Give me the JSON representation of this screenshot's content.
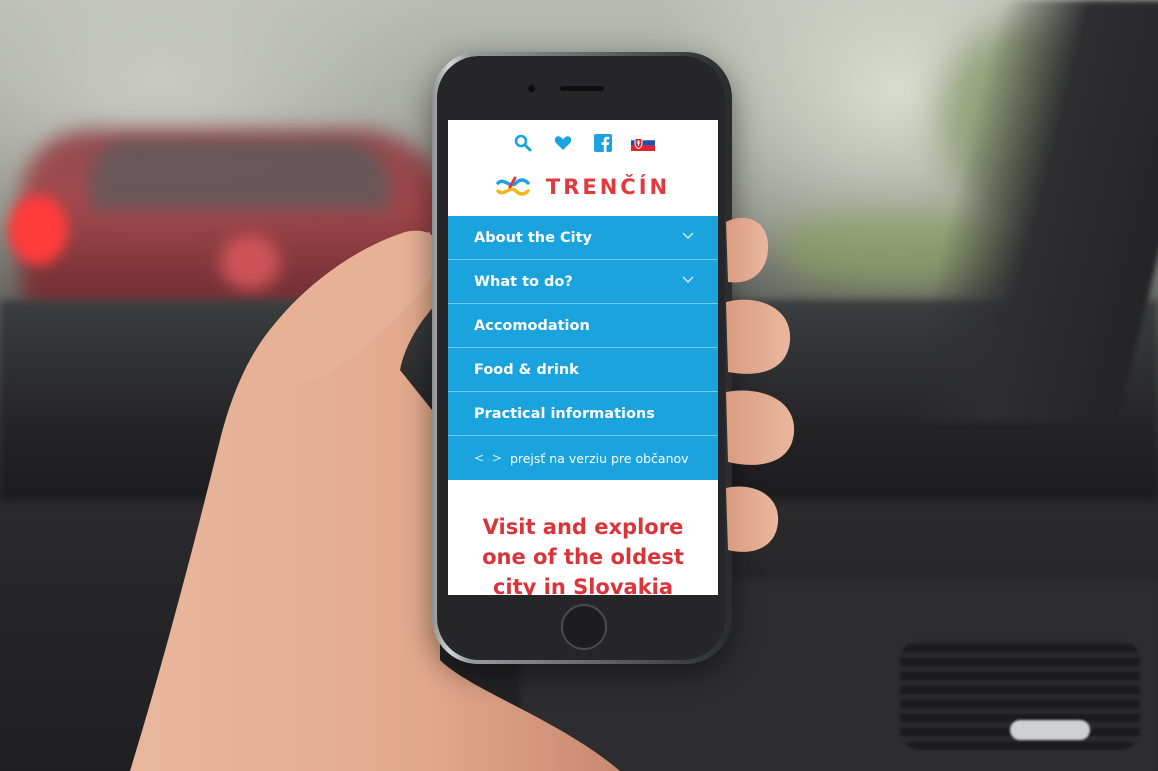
{
  "header": {
    "icons": [
      "search-icon",
      "heart-icon",
      "facebook-icon",
      "slovak-flag-icon"
    ],
    "logo_text": "TRENČÍN"
  },
  "menu": {
    "items": [
      {
        "label": "About the City",
        "has_submenu": true
      },
      {
        "label": "What to do?",
        "has_submenu": true
      },
      {
        "label": "Accomodation",
        "has_submenu": false
      },
      {
        "label": "Food & drink",
        "has_submenu": false
      },
      {
        "label": "Practical informations",
        "has_submenu": false
      }
    ],
    "switch_arrows": "< >",
    "switch_label": "prejsť na verziu pre občanov"
  },
  "hero": {
    "line1": "Visit and explore",
    "line2": "one of the oldest",
    "line3": "city in Slovakia"
  },
  "colors": {
    "menu_blue": "#1aa3dc",
    "brand_red": "#e03a3e",
    "icon_blue": "#1aa3dc"
  }
}
